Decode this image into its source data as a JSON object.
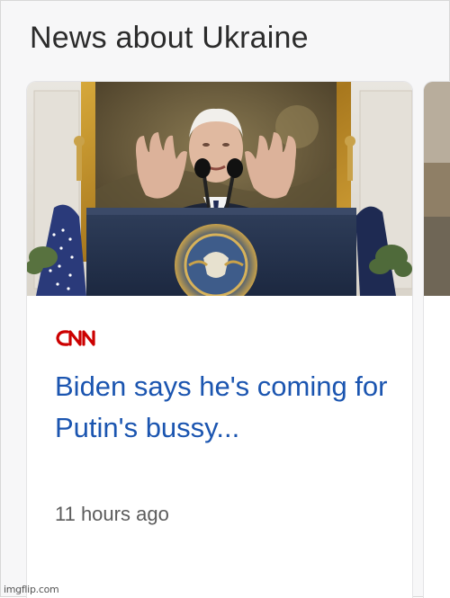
{
  "section": {
    "title": "News about Ukraine"
  },
  "card": {
    "source": "CNN",
    "source_color": "#cc0000",
    "headline": "Biden says he's coming for Putin's bussy...",
    "timestamp": "11 hours ago",
    "headline_color": "#1b55b0",
    "photo_icon": "news-photo-podium"
  },
  "watermark": {
    "text": "imgflip.com"
  }
}
